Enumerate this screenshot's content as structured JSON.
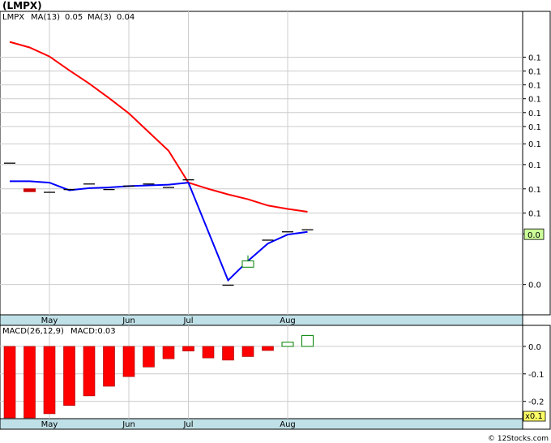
{
  "chart_title": "(LMPX)",
  "watermark": "© 12Stocks.com",
  "colors": {
    "price_up": "#008000",
    "price_down": "#cc0000",
    "ma13": "#ff0000",
    "ma3": "#0000ff",
    "macd_up": "#008000",
    "macd_down": "#ff0000",
    "last_price_box": "#ccff99",
    "date_band": "#bfe0e6",
    "grid": "#cccccc"
  },
  "chart_data": [
    {
      "type": "candlestick",
      "legend": {
        "ticker": "LMPX",
        "ma13_label": "MA(13)",
        "ma13_value": "0.05",
        "ma3_label": "MA(3)",
        "ma3_value": "0.04"
      },
      "x_labels": [
        "May",
        "Jun",
        "Jul",
        "Aug"
      ],
      "x_label_weeks": [
        2,
        6,
        9,
        14
      ],
      "y_tick_labels": [
        "0.1",
        "0.1",
        "0.1",
        "0.1",
        "0.1",
        "0.1",
        "0.1",
        "0.1",
        "0.1",
        "0.1",
        "0.0",
        "0.0"
      ],
      "y_tick_values": [
        0.068,
        0.066,
        0.064,
        0.062,
        0.06,
        0.058,
        0.0555,
        0.0525,
        0.049,
        0.0455,
        0.0425,
        0.0352
      ],
      "ylim": [
        0.032,
        0.0725
      ],
      "last_price_label": "0.0",
      "last_price_value": 0.0424,
      "weeks": [
        0,
        1,
        2,
        3,
        4,
        5,
        6,
        7,
        8,
        9,
        11,
        12,
        13,
        14,
        15
      ],
      "candles": [
        {
          "o": 0.0527,
          "h": 0.0527,
          "l": 0.0527,
          "c": 0.0527
        },
        {
          "o": 0.049,
          "h": 0.049,
          "l": 0.0486,
          "c": 0.0486
        },
        {
          "o": 0.0485,
          "h": 0.0485,
          "l": 0.0485,
          "c": 0.0485
        },
        {
          "o": 0.0489,
          "h": 0.0489,
          "l": 0.0489,
          "c": 0.0489
        },
        {
          "o": 0.0497,
          "h": 0.0497,
          "l": 0.0497,
          "c": 0.0497
        },
        {
          "o": 0.0489,
          "h": 0.0489,
          "l": 0.0489,
          "c": 0.0489
        },
        {
          "o": 0.0494,
          "h": 0.0494,
          "l": 0.0494,
          "c": 0.0494
        },
        {
          "o": 0.0497,
          "h": 0.0497,
          "l": 0.0497,
          "c": 0.0497
        },
        {
          "o": 0.0492,
          "h": 0.0492,
          "l": 0.0492,
          "c": 0.0492
        },
        {
          "o": 0.0503,
          "h": 0.0503,
          "l": 0.0503,
          "c": 0.0503
        },
        {
          "o": 0.0351,
          "h": 0.0351,
          "l": 0.0351,
          "c": 0.0351
        },
        {
          "o": 0.0377,
          "h": 0.0394,
          "l": 0.0377,
          "c": 0.0386
        },
        {
          "o": 0.0416,
          "h": 0.0416,
          "l": 0.0416,
          "c": 0.0416
        },
        {
          "o": 0.0428,
          "h": 0.0428,
          "l": 0.0428,
          "c": 0.0428
        },
        {
          "o": 0.0431,
          "h": 0.0431,
          "l": 0.0431,
          "c": 0.0431
        }
      ],
      "series": [
        {
          "name": "MA(13)",
          "x": [
            0,
            1,
            2,
            3,
            4,
            5,
            6,
            7,
            8,
            9,
            10,
            11,
            12,
            13,
            14,
            15
          ],
          "values": [
            0.0702,
            0.0694,
            0.0681,
            0.0661,
            0.0642,
            0.0621,
            0.0599,
            0.0572,
            0.0545,
            0.0499,
            0.049,
            0.0482,
            0.0475,
            0.0466,
            0.0461,
            0.0457
          ]
        },
        {
          "name": "MA(3)",
          "x": [
            0,
            1,
            2,
            3,
            4,
            5,
            6,
            7,
            8,
            9,
            11,
            12,
            13,
            14,
            15
          ],
          "values": [
            0.0501,
            0.0501,
            0.0499,
            0.0488,
            0.0491,
            0.0492,
            0.0494,
            0.0495,
            0.0496,
            0.0499,
            0.0358,
            0.0386,
            0.0411,
            0.0424,
            0.0428
          ]
        }
      ]
    },
    {
      "type": "bar",
      "legend": {
        "label": "MACD(26,12,9)",
        "value_label": "MACD:0.03"
      },
      "x_labels": [
        "May",
        "Jun",
        "Jul",
        "Aug"
      ],
      "x_label_weeks": [
        2,
        6,
        9,
        14
      ],
      "y_tick_labels": [
        "0.0",
        "-0.1",
        "-0.2"
      ],
      "y_tick_values": [
        0.0,
        -0.1,
        -0.2
      ],
      "ylim": [
        -0.26,
        0.05
      ],
      "multiplier_label": "x0.1",
      "weeks": [
        0,
        1,
        2,
        3,
        4,
        5,
        6,
        7,
        8,
        9,
        10,
        11,
        12,
        13,
        14,
        15
      ],
      "values": [
        -0.26,
        -0.26,
        -0.245,
        -0.215,
        -0.18,
        -0.145,
        -0.11,
        -0.075,
        -0.045,
        -0.017,
        -0.042,
        -0.05,
        -0.037,
        -0.015,
        0.015,
        0.04
      ]
    }
  ]
}
